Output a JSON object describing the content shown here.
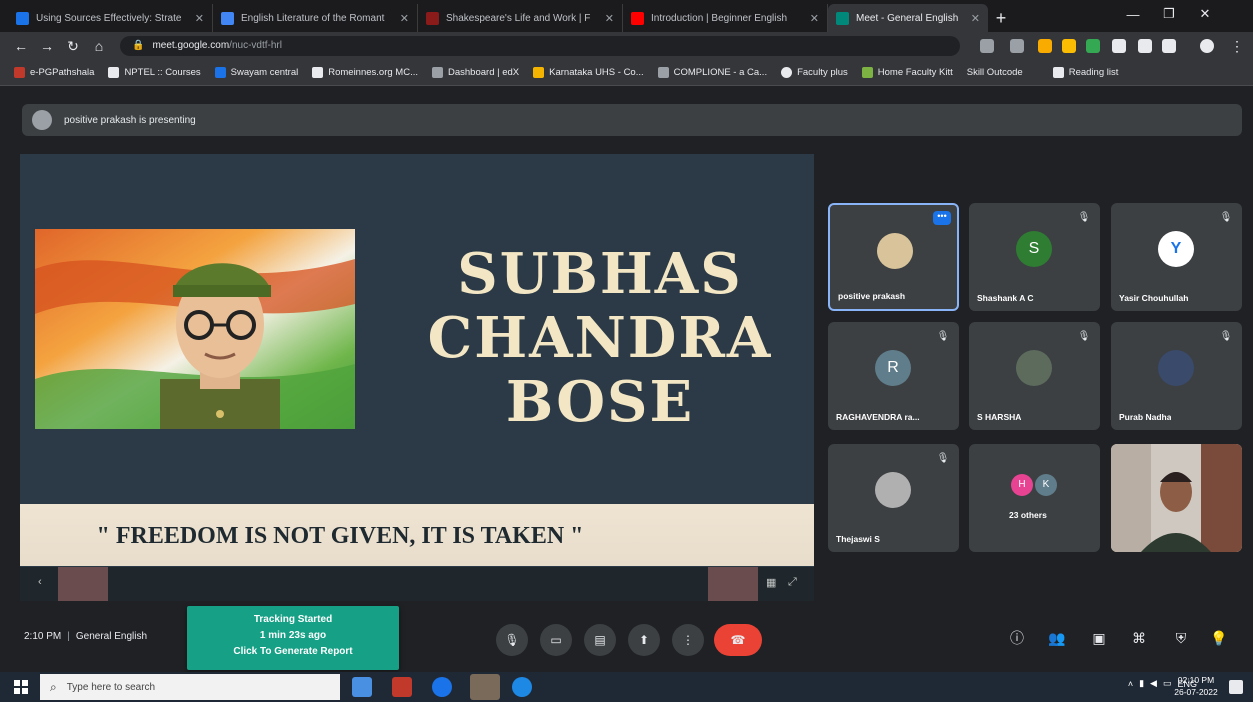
{
  "browser": {
    "tabs": [
      {
        "title": "Using Sources Effectively: Strate",
        "favicon_color": "#1a73e8"
      },
      {
        "title": "English Literature of the Romant",
        "favicon_color": "#4285f4"
      },
      {
        "title": "Shakespeare's Life and Work | F",
        "favicon_color": "#8b1a1a"
      },
      {
        "title": "Introduction | Beginner English",
        "favicon_color": "#ff0000"
      },
      {
        "title": "Meet - General English",
        "favicon_color": "#00897b",
        "active": true
      }
    ],
    "new_tab_label": "+",
    "url_host": "meet.google.com",
    "url_path": "/nuc-vdtf-hrl",
    "bookmarks": [
      {
        "label": "e-PGPathshala",
        "color": "#c0392b"
      },
      {
        "label": "NPTEL :: Courses",
        "color": "#e8eaed"
      },
      {
        "label": "Swayam central",
        "color": "#1a73e8"
      },
      {
        "label": "Romeinnes.org MC...",
        "color": "#e8eaed"
      },
      {
        "label": "Dashboard | edX",
        "color": "#9aa0a6"
      },
      {
        "label": "Karnataka UHS - Co...",
        "color": "#f4b400"
      },
      {
        "label": "COMPLIONE - a Ca...",
        "color": "#9aa0a6"
      },
      {
        "label": "Faculty plus",
        "color": "#e8eaed"
      },
      {
        "label": "Home Faculty Kitt",
        "color": "#7cb342"
      },
      {
        "label": "Skill Outcode",
        "color": "#9aa0a6"
      },
      {
        "label": "Reading list",
        "color": "#e8eaed"
      }
    ]
  },
  "meet": {
    "presenting_text": "positive prakash is presenting",
    "slide": {
      "title_lines": [
        "SUBHAS",
        "CHANDRA",
        "BOSE"
      ],
      "quote": "\" FREEDOM IS NOT GIVEN, IT IS TAKEN \""
    },
    "participants": [
      {
        "name": "positive prakash",
        "avatar_letter": "",
        "avatar_color": "#d8c39a",
        "active": true
      },
      {
        "name": "Shashank A C",
        "avatar_letter": "S",
        "avatar_color": "#2e7d32"
      },
      {
        "name": "Yasir Chouhullah",
        "avatar_letter": "Y",
        "avatar_color": "#ffffff"
      },
      {
        "name": "RAGHAVENDRA ra...",
        "avatar_letter": "R",
        "avatar_color": "#607d8b"
      },
      {
        "name": "S HARSHA",
        "avatar_letter": "",
        "avatar_color": "#5d6b5d"
      },
      {
        "name": "Purab Nadha",
        "avatar_letter": "",
        "avatar_color": "#3a4a6b"
      },
      {
        "name": "Thejaswi S",
        "avatar_letter": "",
        "avatar_color": "#b0b0b0"
      },
      {
        "name": "23 others",
        "avatar_letter": "",
        "avatar_color": "#e84393"
      },
      {
        "name": "",
        "avatar_letter": "",
        "avatar_color": "#8d6e63"
      }
    ],
    "others_letters": [
      "H",
      "K"
    ],
    "bottom": {
      "time": "2:10 PM",
      "meeting_name": "General English"
    },
    "tracking": {
      "line1": "Tracking Started",
      "line2": "1 min 23s ago",
      "line3": "Click To Generate Report"
    }
  },
  "taskbar": {
    "search_placeholder": "Type here to search",
    "tray_lang": "ENG",
    "clock_time": "02:10 PM",
    "clock_date": "26-07-2022"
  },
  "colors": {
    "meet_bg": "#202124",
    "tile_bg": "#3c4043",
    "end_call": "#ea4335",
    "tracking_bg": "#16a085",
    "slide_bg": "#2b3a46",
    "title_text": "#f3e6c4"
  }
}
